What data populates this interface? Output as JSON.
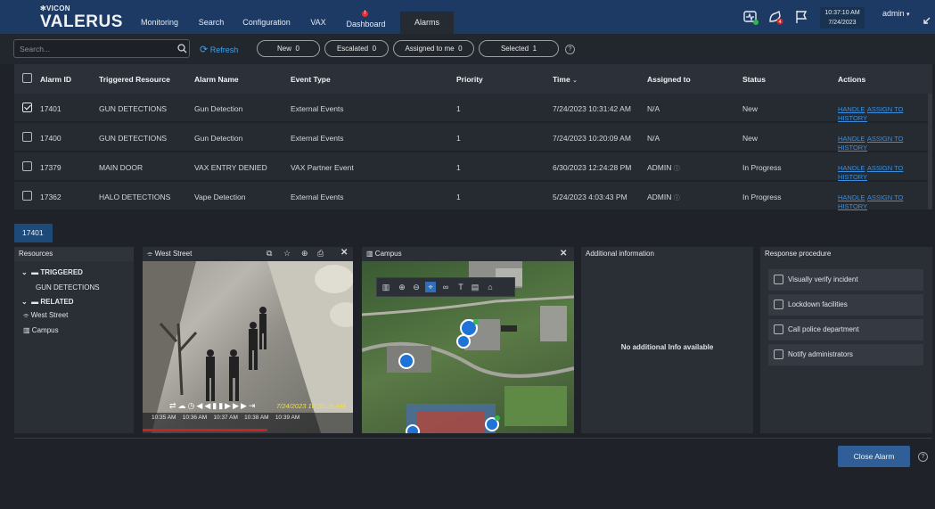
{
  "brand": {
    "top": "VICON",
    "main": "VALERUS"
  },
  "nav": [
    {
      "label": "Monitoring"
    },
    {
      "label": "Search"
    },
    {
      "label": "Configuration"
    },
    {
      "label": "VAX"
    },
    {
      "label": "Dashboard"
    },
    {
      "label": "Alarms"
    }
  ],
  "topbar": {
    "time": "10:37:10 AM",
    "date": "7/24/2023",
    "user": "admin",
    "notif_badge": "4"
  },
  "filters": {
    "search_placeholder": "Search...",
    "refresh": "Refresh",
    "new": "New",
    "new_count": "0",
    "escalated": "Escalated",
    "escalated_count": "0",
    "assigned": "Assigned to me",
    "assigned_count": "0",
    "selected": "Selected",
    "selected_count": "1"
  },
  "table": {
    "headers": [
      "Alarm ID",
      "Triggered Resource",
      "Alarm Name",
      "Event Type",
      "Priority",
      "Time",
      "Assigned to",
      "Status",
      "Actions"
    ],
    "rows": [
      {
        "id": "17401",
        "resource": "GUN DETECTIONS",
        "name": "Gun Detection",
        "event": "External Events",
        "priority": "1",
        "time": "7/24/2023 10:31:42 AM",
        "assigned": "N/A",
        "status": "New",
        "checked": true
      },
      {
        "id": "17400",
        "resource": "GUN DETECTIONS",
        "name": "Gun Detection",
        "event": "External Events",
        "priority": "1",
        "time": "7/24/2023 10:20:09 AM",
        "assigned": "N/A",
        "status": "New",
        "checked": false
      },
      {
        "id": "17379",
        "resource": "MAIN DOOR",
        "name": "VAX ENTRY DENIED",
        "event": "VAX Partner Event",
        "priority": "1",
        "time": "6/30/2023 12:24:28 PM",
        "assigned": "ADMIN",
        "status": "In Progress",
        "checked": false
      },
      {
        "id": "17362",
        "resource": "HALO DETECTIONS",
        "name": "Vape Detection",
        "event": "External Events",
        "priority": "1",
        "time": "5/24/2023 4:03:43 PM",
        "assigned": "ADMIN",
        "status": "In Progress",
        "checked": false
      }
    ],
    "actions": {
      "handle": "HANDLE",
      "assign": "ASSIGN TO",
      "history": "HISTORY"
    }
  },
  "detail": {
    "tab": "17401",
    "resources_title": "Resources",
    "triggered": "TRIGGERED",
    "triggered_item": "GUN DETECTIONS",
    "related": "RELATED",
    "related_items": [
      "West Street",
      "Campus"
    ],
    "video_title": "West Street",
    "video_timestamp": "7/24/2023 10:36:25 AM",
    "video_times": [
      "10:35 AM",
      "10:36 AM",
      "10:37 AM",
      "10:38 AM",
      "10:39 AM"
    ],
    "map_title": "Campus",
    "info_title": "Additional information",
    "info_empty": "No additional Info available",
    "procedure_title": "Response procedure",
    "procedure_items": [
      "Visually verify incident",
      "Lockdown facilities",
      "Call police department",
      "Notify administrators"
    ]
  },
  "footer": {
    "close_alarm": "Close Alarm"
  },
  "colors": {
    "topbar": "#1c3a63",
    "accent": "#3b8fe0",
    "panel": "#2a2e35"
  }
}
